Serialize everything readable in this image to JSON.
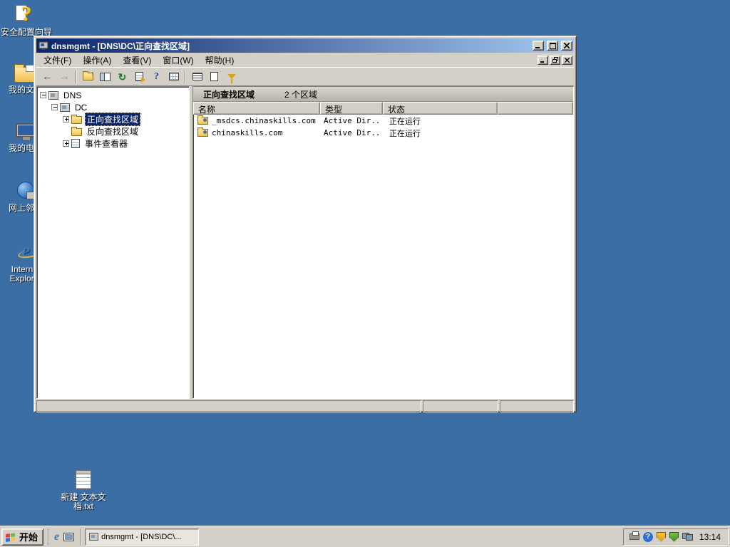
{
  "icons": {
    "question_glyph": "?",
    "back_glyph": "←",
    "forward_glyph": "→",
    "up_glyph": "↑",
    "refresh_glyph": "↻",
    "help_glyph": "?",
    "ie_glyph": "e",
    "tray_help_glyph": "?"
  },
  "desktop": {
    "icons": [
      {
        "label": "安全配置向导"
      },
      {
        "label": "我的文档"
      },
      {
        "label": "我的电脑"
      },
      {
        "label": "网上邻居"
      },
      {
        "label": "Internet Explorer"
      },
      {
        "label": "新建 文本文档.txt"
      }
    ]
  },
  "window": {
    "title": "dnsmgmt - [DNS\\DC\\正向查找区域]",
    "menu": [
      "文件(F)",
      "操作(A)",
      "查看(V)",
      "窗口(W)",
      "帮助(H)"
    ],
    "tree": {
      "nodes": [
        {
          "label": "DNS"
        },
        {
          "label": "DC"
        },
        {
          "label": "正向查找区域"
        },
        {
          "label": "反向查找区域"
        },
        {
          "label": "事件查看器"
        }
      ]
    },
    "result": {
      "header_title": "正向查找区域",
      "header_count": "2 个区域",
      "columns": [
        "名称",
        "类型",
        "状态"
      ],
      "rows": [
        {
          "name": "_msdcs.chinaskills.com",
          "type": "Active Dir...",
          "status": "正在运行"
        },
        {
          "name": "chinaskills.com",
          "type": "Active Dir...",
          "status": "正在运行"
        }
      ]
    }
  },
  "taskbar": {
    "start_label": "开始",
    "task_button": "dnsmgmt - [DNS\\DC\\...",
    "clock": "13:14"
  },
  "colors": {
    "desktop": "#3A6EA5",
    "title_gradient_start": "#0A246A",
    "title_gradient_end": "#A6CAF0",
    "selection": "#0A246A",
    "chrome": "#D4D0C8"
  }
}
